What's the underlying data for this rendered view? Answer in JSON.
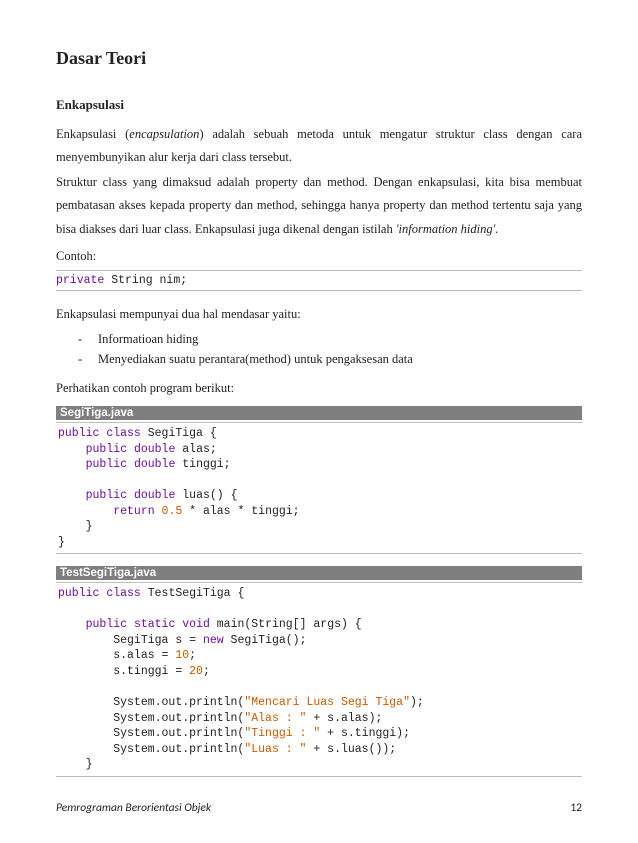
{
  "title": "Dasar Teori",
  "section": "Enkapsulasi",
  "para1": "Enkapsulasi (encapsulation) adalah sebuah metoda untuk mengatur struktur class dengan cara menyembunyikan alur kerja dari class tersebut.",
  "para2": "Struktur class yang dimaksud adalah property dan method. Dengan enkapsulasi, kita bisa membuat pembatasan akses kepada property dan method, sehingga hanya property dan method tertentu saja yang bisa diakses dari luar class. Enkapsulasi juga dikenal dengan istilah ",
  "para2_em": "'information hiding'.",
  "contoh_label": "Contoh:",
  "code_inline": "private String nim;",
  "para3": "Enkapsulasi mempunyai dua hal mendasar yaitu:",
  "bullets": [
    "Informatioan hiding",
    "Menyediakan suatu perantara(method) untuk pengaksesan data"
  ],
  "para4": "Perhatikan contoh program berikut:",
  "file1": "SegiTiga.java",
  "code1": "public class SegiTiga {\n    public double alas;\n    public double tinggi;\n\n    public double luas() {\n        return 0.5 * alas * tinggi;\n    }\n}",
  "file2": "TestSegiTiga.java",
  "code2": "public class TestSegiTiga {\n\n    public static void main(String[] args) {\n        SegiTiga s = new SegiTiga();\n        s.alas = 10;\n        s.tinggi = 20;\n\n        System.out.println(\"Mencari Luas Segi Tiga\");\n        System.out.println(\"Alas : \" + s.alas);\n        System.out.println(\"Tinggi : \" + s.tinggi);\n        System.out.println(\"Luas : \" + s.luas());\n    }",
  "footer_left": "Pemrograman Berorientasi Objek",
  "footer_right": "12"
}
